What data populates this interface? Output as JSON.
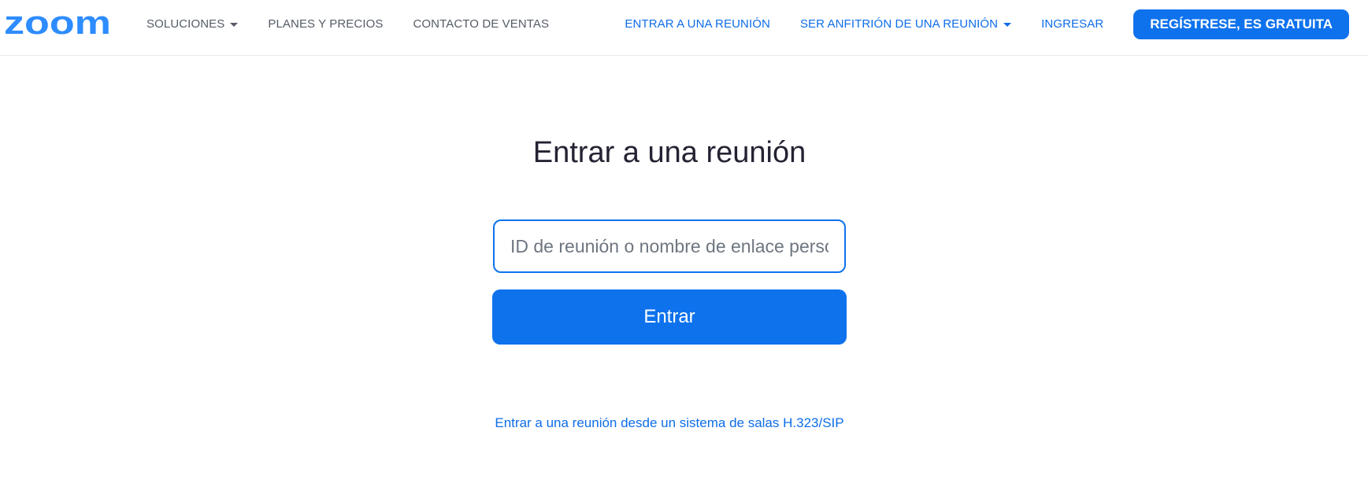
{
  "header": {
    "logo_text": "zoom",
    "brand_color": "#2D8CFF",
    "nav_left": [
      {
        "label": "SOLUCIONES",
        "dropdown": true
      },
      {
        "label": "PLANES Y PRECIOS",
        "dropdown": false
      },
      {
        "label": "CONTACTO DE VENTAS",
        "dropdown": false
      }
    ],
    "nav_right": [
      {
        "label": "ENTRAR A UNA REUNIÓN",
        "dropdown": false
      },
      {
        "label": "SER ANFITRIÓN DE UNA REUNIÓN",
        "dropdown": true
      },
      {
        "label": "INGRESAR",
        "dropdown": false
      }
    ],
    "signup_label": "REGÍSTRESE, ES GRATUITA"
  },
  "main": {
    "title": "Entrar a una reunión",
    "input": {
      "value": "",
      "placeholder": "ID de reunión o nombre de enlace personal"
    },
    "join_button_label": "Entrar",
    "h323_link": "Entrar a una reunión desde un sistema de salas H.323/SIP"
  },
  "colors": {
    "accent": "#0E72ED",
    "link": "#0E6DE8",
    "nav_text": "#555B66",
    "title_text": "#232333"
  }
}
